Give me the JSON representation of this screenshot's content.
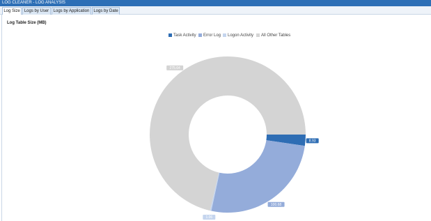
{
  "window": {
    "title": "LOG CLEANER - LOG ANALYSIS"
  },
  "tabs": [
    {
      "label": "Log Size",
      "active": true
    },
    {
      "label": "Logs by User",
      "active": false
    },
    {
      "label": "Logs by Application",
      "active": false
    },
    {
      "label": "Logs by Date",
      "active": false
    }
  ],
  "chart_data": {
    "type": "pie",
    "donut": true,
    "title": "Log Table Size (MB)",
    "legend_position": "top",
    "series": [
      {
        "name": "Task Activity",
        "value": 8.93,
        "label": "8.93",
        "color": "#2e6db4"
      },
      {
        "name": "Error Log",
        "value": 100.68,
        "label": "100.68",
        "color": "#94acda"
      },
      {
        "name": "Logon Activity",
        "value": 1.06,
        "label": "1.06",
        "color": "#c5d5ee"
      },
      {
        "name": "All Other Tables",
        "value": 275.64,
        "label": "275.64",
        "color": "#d4d4d4"
      }
    ]
  }
}
